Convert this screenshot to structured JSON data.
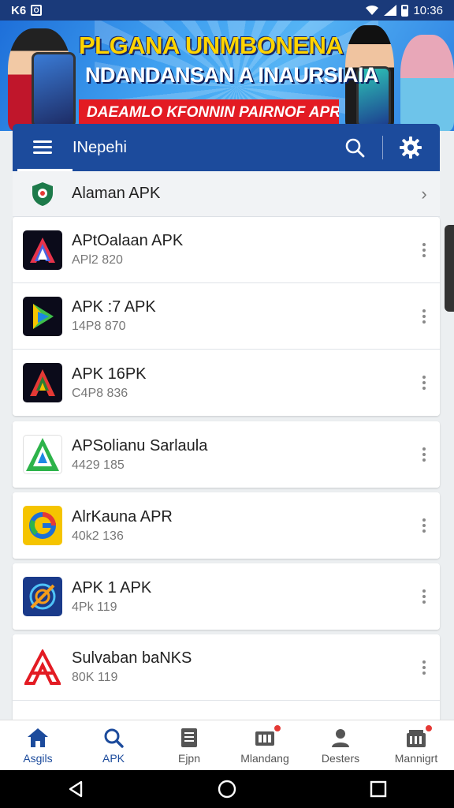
{
  "status_bar": {
    "left_text": "K6",
    "left_box": "O",
    "time": "10:36"
  },
  "banner": {
    "title": "PLGANA UNMBONENA",
    "subtitle": "NDANDANSAN A INAURSIAIA",
    "strip": "DAEAMLO KFONNIN PAIRNOF APR"
  },
  "app_bar": {
    "title": "INepehi"
  },
  "header_row": {
    "title": "Alaman APK"
  },
  "items": [
    {
      "title": "APtOalaan APK",
      "sub": "APl2 820",
      "color": "#0b0b1a",
      "accent": "#e8334a"
    },
    {
      "title": "APK :7 APK",
      "sub": "14P8 870",
      "color": "#0b0b1a",
      "accent": "#3fbf4a"
    },
    {
      "title": "APK 16PK",
      "sub": "C4P8 836",
      "color": "#0b0b1a",
      "accent": "#e53935"
    },
    {
      "title": "APSolianu Sarlaula",
      "sub": "4429 185",
      "color": "#ffffff",
      "accent": "#2db34a"
    },
    {
      "title": "AlrKauna APR",
      "sub": "40k2 136",
      "color": "#f5c400",
      "accent": "#1c6fd6"
    },
    {
      "title": "APK 1 APK",
      "sub": "4Pk 119",
      "color": "#1a3a8a",
      "accent": "#f59c1a"
    },
    {
      "title": "Sulvaban baNKS",
      "sub": "80K 119",
      "color": "#ffffff",
      "accent": "#e31b23"
    }
  ],
  "bottom_nav": [
    {
      "label": "Asgils",
      "icon": "home-icon",
      "active": true
    },
    {
      "label": "APK",
      "icon": "search-icon",
      "active": true
    },
    {
      "label": "Ejpn",
      "icon": "document-icon",
      "active": false
    },
    {
      "label": "Mlandang",
      "icon": "storage-icon",
      "active": false
    },
    {
      "label": "Desters",
      "icon": "profile-icon",
      "active": false
    },
    {
      "label": "Mannigrt",
      "icon": "shop-icon",
      "active": false
    }
  ]
}
